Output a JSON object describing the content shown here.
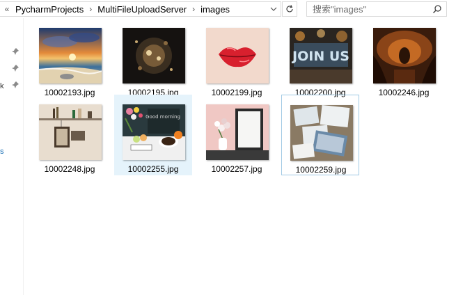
{
  "breadcrumb": {
    "crumbs": [
      "PycharmProjects",
      "MultiFileUploadServer",
      "images"
    ]
  },
  "search": {
    "placeholder": "搜索\"images\""
  },
  "icons": {
    "back": "double-chevron-left-icon",
    "sep": "chevron-right-icon",
    "dropdown": "chevron-down-icon",
    "refresh": "refresh-icon",
    "search": "search-icon",
    "pin": "pin-icon"
  },
  "colors": {
    "selection": "#e5f3fb",
    "focus_border": "#9fc9e4"
  },
  "files": [
    {
      "name": "10002193.jpg",
      "selected": false
    },
    {
      "name": "10002195.jpg",
      "selected": false
    },
    {
      "name": "10002199.jpg",
      "selected": false
    },
    {
      "name": "10002200.jpg",
      "selected": false
    },
    {
      "name": "10002246.jpg",
      "selected": false
    },
    {
      "name": "10002248.jpg",
      "selected": false
    },
    {
      "name": "10002255.jpg",
      "selected": true
    },
    {
      "name": "10002257.jpg",
      "selected": false
    },
    {
      "name": "10002259.jpg",
      "selected": false
    }
  ],
  "thumb_texts": {
    "joinus": "JOIN US",
    "coffee_note": "Good morning"
  }
}
